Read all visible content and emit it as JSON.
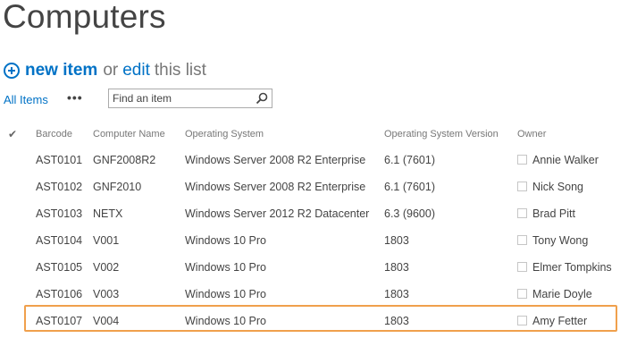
{
  "page": {
    "title": "Computers"
  },
  "actions": {
    "new_item": "new item",
    "or": "or",
    "edit": "edit",
    "this_list": "this list"
  },
  "view": {
    "all_items": "All Items",
    "more": "•••",
    "search_placeholder": "Find an item"
  },
  "table": {
    "columns": [
      "Barcode",
      "Computer Name",
      "Operating System",
      "Operating System Version",
      "Owner"
    ],
    "rows": [
      {
        "barcode": "AST0101",
        "name": "GNF2008R2",
        "os": "Windows Server 2008 R2 Enterprise",
        "version": "6.1 (7601)",
        "owner": "Annie Walker"
      },
      {
        "barcode": "AST0102",
        "name": "GNF2010",
        "os": "Windows Server 2008 R2 Enterprise",
        "version": "6.1 (7601)",
        "owner": "Nick Song"
      },
      {
        "barcode": "AST0103",
        "name": "NETX",
        "os": "Windows Server 2012 R2 Datacenter",
        "version": "6.3 (9600)",
        "owner": "Brad Pitt"
      },
      {
        "barcode": "AST0104",
        "name": "V001",
        "os": "Windows 10 Pro",
        "version": "1803",
        "owner": "Tony Wong"
      },
      {
        "barcode": "AST0105",
        "name": "V002",
        "os": "Windows 10 Pro",
        "version": "1803",
        "owner": "Elmer Tompkins"
      },
      {
        "barcode": "AST0106",
        "name": "V003",
        "os": "Windows 10 Pro",
        "version": "1803",
        "owner": "Marie Doyle"
      },
      {
        "barcode": "AST0107",
        "name": "V004",
        "os": "Windows 10 Pro",
        "version": "1803",
        "owner": "Amy Fetter"
      }
    ]
  },
  "colors": {
    "accent": "#0072c6",
    "highlight": "#f0a04c",
    "text": "#444444",
    "muted": "#777777"
  },
  "icons": {
    "add": "plus-circle-icon",
    "search": "search-icon",
    "select_all": "checkmark-icon"
  }
}
